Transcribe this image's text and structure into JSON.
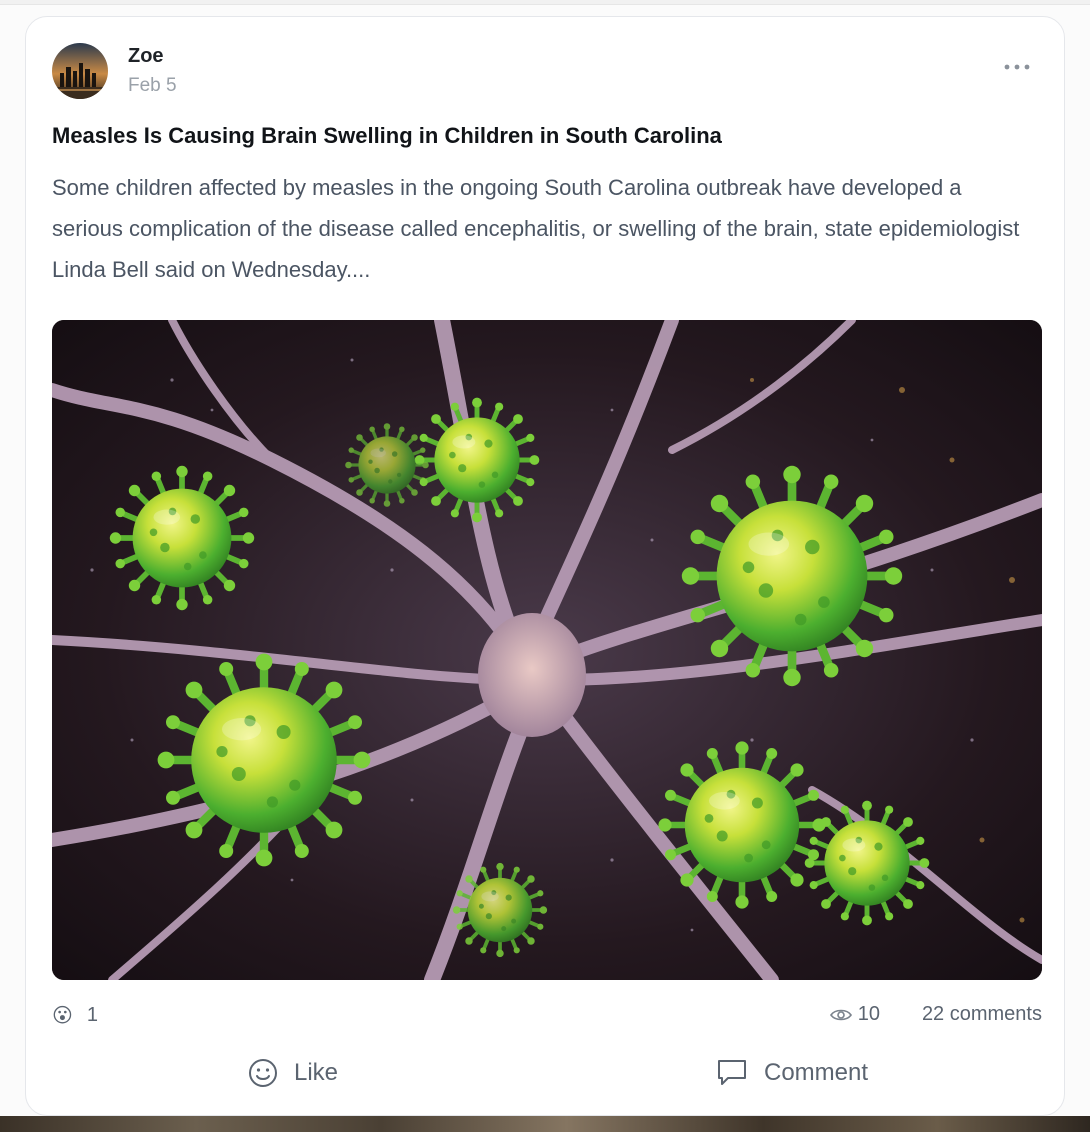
{
  "post": {
    "author": "Zoe",
    "date": "Feb 5",
    "title": "Measles Is Causing Brain Swelling in Children in South Carolina",
    "excerpt": "Some children affected by measles in the ongoing South Carolina outbreak have developed a serious complication of the disease called encephalitis, or swelling of the brain, state epidemiologist Linda Bell said on Wednesday....",
    "image_icon": "virus-illustration",
    "reaction": {
      "emoji": "😮",
      "count": "1"
    },
    "views": "10",
    "comments": "22 comments"
  },
  "actions": {
    "like_label": "Like",
    "comment_label": "Comment"
  },
  "icons": {
    "more": "more-horizontal-icon",
    "eye": "eye-icon",
    "smiley": "smiley-icon",
    "speech": "speech-bubble-icon"
  },
  "colors": {
    "virus_green": "#4caf2f",
    "virus_yellow": "#d6e63a",
    "neuron": "#b59ab3",
    "background_dark": "#1b1216"
  }
}
